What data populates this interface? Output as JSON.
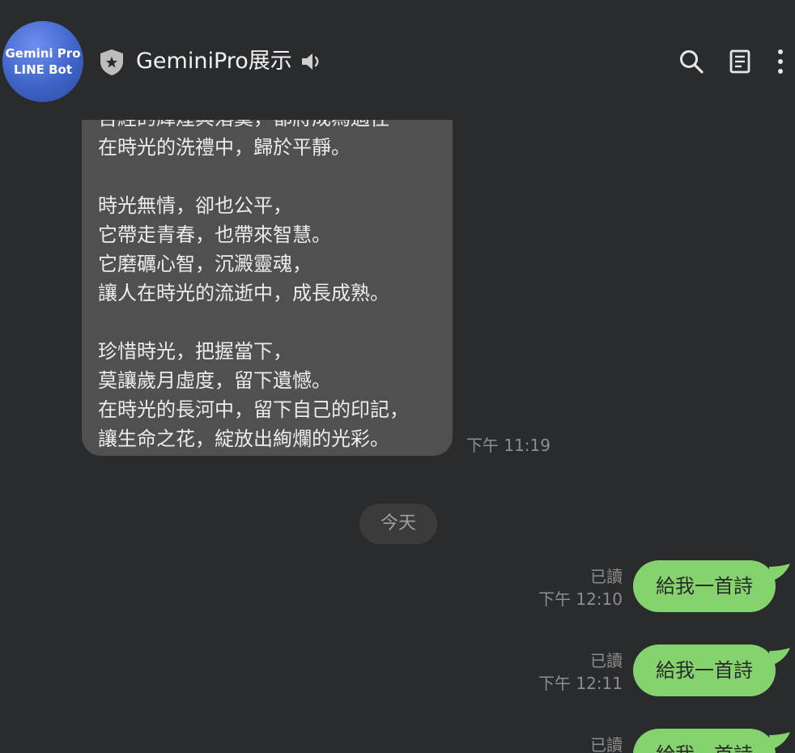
{
  "header": {
    "avatar_line1": "Gemini Pro",
    "avatar_line2": "LINE Bot",
    "title": "GeminiPro展示",
    "icons": [
      "shield-icon",
      "speaker-icon",
      "search-icon",
      "notes-icon",
      "more-icon"
    ]
  },
  "bot_message": {
    "cut_line": "吉經的輝煌與落寞，都將成為過往",
    "lines": [
      "在時光的洗禮中，歸於平靜。",
      "",
      "時光無情，卻也公平，",
      "它帶走青春，也帶來智慧。",
      "它磨礪心智，沉澱靈魂，",
      "讓人在時光的流逝中，成長成熟。",
      "",
      "珍惜時光，把握當下，",
      "莫讓歲月虛度，留下遺憾。",
      "在時光的長河中，留下自己的印記，",
      "讓生命之花，綻放出絢爛的光彩。"
    ],
    "time": "下午 11:19"
  },
  "date_divider": "今天",
  "user_messages": [
    {
      "read": "已讀",
      "time": "下午 12:10",
      "text": "給我一首詩"
    },
    {
      "read": "已讀",
      "time": "下午 12:11",
      "text": "給我一首詩"
    },
    {
      "read": "已讀",
      "time": "",
      "text": "給我一首詩"
    }
  ],
  "colors": {
    "background": "#2a2b2d",
    "bot_bubble": "#505050",
    "user_bubble": "#84d36c",
    "avatar": "#3f64c8"
  }
}
